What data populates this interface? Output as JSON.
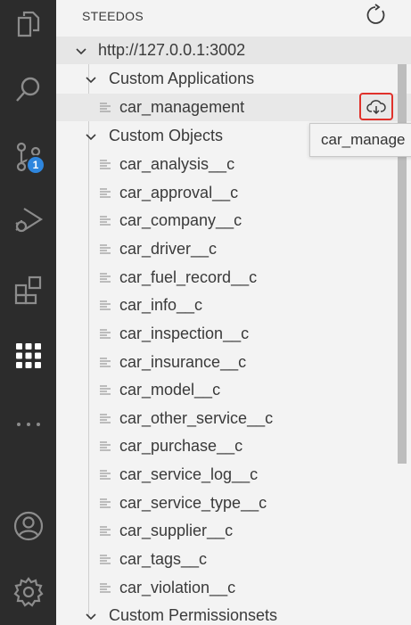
{
  "activity_bar": {
    "scm_badge": "1",
    "icons": [
      "explorer-icon",
      "search-icon",
      "source-control-icon",
      "run-debug-icon",
      "extensions-icon",
      "apps-grid-icon",
      "more-icon",
      "account-icon",
      "settings-icon"
    ]
  },
  "sidebar": {
    "title": "STEEDOS",
    "refresh_icon": "refresh-icon",
    "root": "http://127.0.0.1:3002",
    "groups": {
      "custom_applications": "Custom Applications",
      "custom_objects": "Custom Objects",
      "custom_permissionsets": "Custom Permissionsets"
    },
    "applications": [
      "car_management"
    ],
    "objects": [
      "car_analysis__c",
      "car_approval__c",
      "car_company__c",
      "car_driver__c",
      "car_fuel_record__c",
      "car_info__c",
      "car_inspection__c",
      "car_insurance__c",
      "car_model__c",
      "car_other_service__c",
      "car_purchase__c",
      "car_service_log__c",
      "car_service_type__c",
      "car_supplier__c",
      "car_tags__c",
      "car_violation__c"
    ],
    "tooltip": "car_manage",
    "download_icon": "cloud-download-icon"
  },
  "colors": {
    "activity_bar_bg": "#2c2c2c",
    "sidebar_bg": "#f3f3f3",
    "badge": "#2e86de",
    "highlight_box": "#e0312b"
  }
}
